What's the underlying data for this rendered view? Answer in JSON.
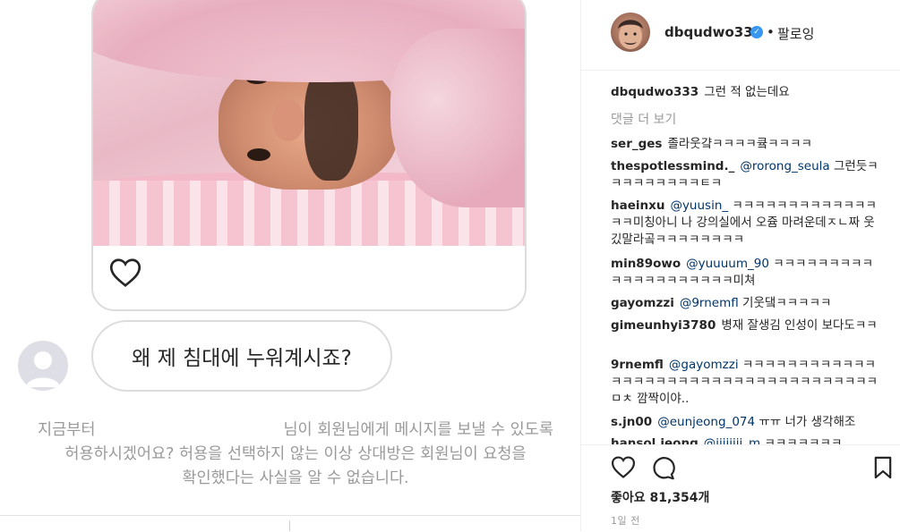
{
  "post": {
    "dm_message": "왜 제 침대에 누워계시죠?",
    "request_line1_a": "지금부터",
    "request_line1_b": "님이 회원님에게 메시지를 보낼 수 있도록",
    "request_line2": "허용하시겠어요? 허용을 선택하지 않는 이상 상대방은 회원님이 요청을",
    "request_line3": "확인했다는 사실을 알 수 없습니다."
  },
  "header": {
    "username": "dbqudwo333",
    "separator": "•",
    "follow_label": "팔로잉"
  },
  "caption": {
    "user": "dbqudwo333",
    "text": "그런 적 없는데요"
  },
  "view_more": "댓글 더 보기",
  "comments": [
    {
      "user": "ser_ges",
      "text": "졸라웃걐ㅋㅋㅋㅋ큨ㅋㅋㅋㅋ"
    },
    {
      "user": "thespotlessmind._",
      "mention": "@rorong_seula",
      "text": " 그런듯ㅋㅋㅋㅋㅋㅋㅋㅋㅋㅌㅋ"
    },
    {
      "user": "haeinxu",
      "mention": "@yuusin_",
      "text": " ㅋㅋㅋㅋㅋㅋㅋㅋㅋㅋㅋㅋㅋㅋㅋ미칭아니 나 강의실에서 오쥼 마려운데ㅈㄴ짜 웃깄말라곸ㅋㅋㅋㅋㅋㅋㅋㅋ"
    },
    {
      "user": "min89owo",
      "mention": "@yuuuum_90",
      "text": " ㅋㅋㅋㅋㅋㅋㅋㅋㅋㅋㅋㅋㅋㅋㅋㅋㅋㅋㅋㅋ미쳐"
    },
    {
      "user": "gayomzzi",
      "mention": "@9rnemfl",
      "text": " 기웃댘ㅋㅋㅋㅋㅋ"
    },
    {
      "user": "gimeunhyi3780",
      "text": "병재 잘생김 인성이 보다도ㅋㅋ"
    },
    {
      "user": "9rnemfl",
      "mention": "@gayomzzi",
      "text": " ㅋㅋㅋㅋㅋㅋㅋㅋㅋㅋㅋㅋㅋㅋㅋㅋㅋㅋㅋㅋㅋㅋㅋㅋㅋㅋㅋㅋㅋㅋㅋㅋㅋㅋㅋㅋㅁㅊ 깜짝이야.."
    },
    {
      "user": "s.jn00",
      "mention": "@eunjeong_074",
      "text": " ㅠㅠ 너가 생각해조"
    },
    {
      "user": "hansol.jeong",
      "mention": "@jjjjjjjj_m",
      "text": " ㅋㅋㅋㅋㅋㅋㅋ"
    }
  ],
  "likes": "좋아요 81,354개",
  "time": "1일 전",
  "icons": [
    "heart-icon",
    "comment-icon",
    "bookmark-icon",
    "verified-icon",
    "avatar"
  ]
}
